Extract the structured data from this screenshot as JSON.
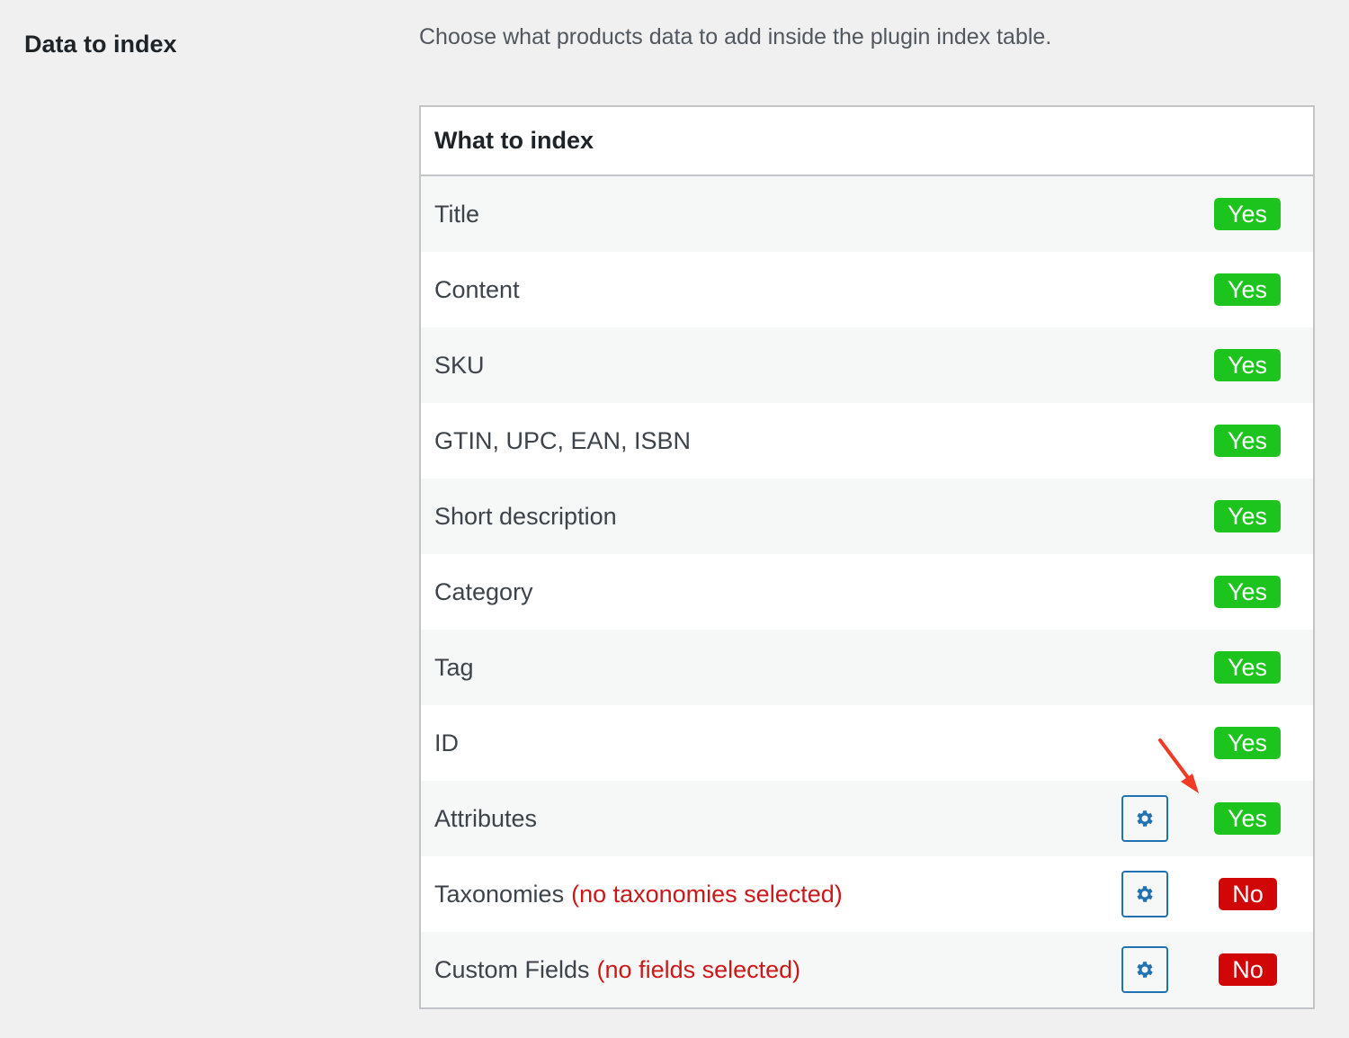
{
  "section": {
    "label": "Data to index",
    "description": "Choose what products data to add inside the plugin index table."
  },
  "table": {
    "header": "What to index",
    "rows": [
      {
        "label": "Title",
        "note": "",
        "has_settings": false,
        "status": "Yes"
      },
      {
        "label": "Content",
        "note": "",
        "has_settings": false,
        "status": "Yes"
      },
      {
        "label": "SKU",
        "note": "",
        "has_settings": false,
        "status": "Yes"
      },
      {
        "label": "GTIN, UPC, EAN, ISBN",
        "note": "",
        "has_settings": false,
        "status": "Yes"
      },
      {
        "label": "Short description",
        "note": "",
        "has_settings": false,
        "status": "Yes"
      },
      {
        "label": "Category",
        "note": "",
        "has_settings": false,
        "status": "Yes"
      },
      {
        "label": "Tag",
        "note": "",
        "has_settings": false,
        "status": "Yes"
      },
      {
        "label": "ID",
        "note": "",
        "has_settings": false,
        "status": "Yes"
      },
      {
        "label": "Attributes",
        "note": "",
        "has_settings": true,
        "status": "Yes"
      },
      {
        "label": "Taxonomies",
        "note": "(no taxonomies selected)",
        "has_settings": true,
        "status": "No"
      },
      {
        "label": "Custom Fields",
        "note": "(no fields selected)",
        "has_settings": true,
        "status": "No"
      }
    ]
  },
  "colors": {
    "yes_badge": "#1ec41e",
    "no_badge": "#d10606",
    "note_text": "#cc1818",
    "gear_accent": "#2271b1",
    "annotation_arrow": "#ef3b24"
  },
  "icons": {
    "settings": "gear-icon",
    "annotation": "red-arrow-annotation"
  }
}
